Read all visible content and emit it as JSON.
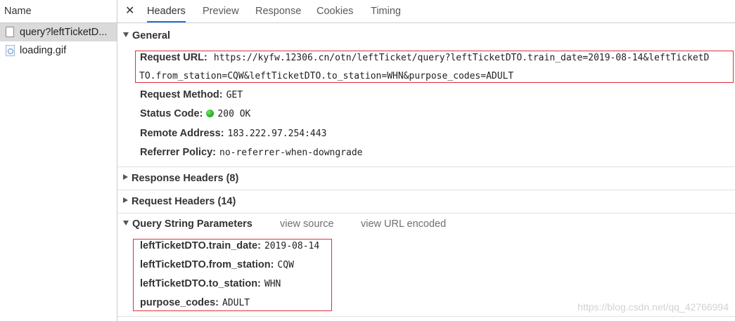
{
  "request_list": {
    "header": "Name",
    "items": [
      {
        "name": "query?leftTicketD..."
      },
      {
        "name": "loading.gif"
      }
    ]
  },
  "tabs": [
    "Headers",
    "Preview",
    "Response",
    "Cookies",
    "Timing"
  ],
  "active_tab": "Headers",
  "general": {
    "title": "General",
    "request_url_label": "Request URL:",
    "request_url_line1": "https://kyfw.12306.cn/otn/leftTicket/query?leftTicketDTO.train_date=2019-08-14&leftTicketD",
    "request_url_line2": "TO.from_station=CQW&leftTicketDTO.to_station=WHN&purpose_codes=ADULT",
    "request_method_label": "Request Method:",
    "request_method": "GET",
    "status_code_label": "Status Code:",
    "status_code": "200 OK",
    "status_color": "#27b627",
    "remote_address_label": "Remote Address:",
    "remote_address": "183.222.97.254:443",
    "referrer_policy_label": "Referrer Policy:",
    "referrer_policy": "no-referrer-when-downgrade"
  },
  "response_headers": {
    "title": "Response Headers (8)"
  },
  "request_headers": {
    "title": "Request Headers (14)"
  },
  "query_string": {
    "title": "Query String Parameters",
    "view_source": "view source",
    "view_url_encoded": "view URL encoded",
    "params": [
      {
        "key": "leftTicketDTO.train_date:",
        "value": "2019-08-14"
      },
      {
        "key": "leftTicketDTO.from_station:",
        "value": "CQW"
      },
      {
        "key": "leftTicketDTO.to_station:",
        "value": "WHN"
      },
      {
        "key": "purpose_codes:",
        "value": "ADULT"
      }
    ]
  },
  "watermark": "https://blog.csdn.net/qq_42766994",
  "colors": {
    "accent": "#1a73e8",
    "highlight_box": "#e0303a",
    "selected_row": "#dadada"
  }
}
